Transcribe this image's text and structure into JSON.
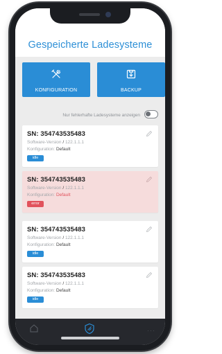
{
  "header": {
    "title": "Gespeicherte Ladesysteme"
  },
  "actions": [
    {
      "label": "KONFIGURATION",
      "icon": "tools-icon"
    },
    {
      "label": "BACKUP",
      "icon": "backup-icon"
    }
  ],
  "filter": {
    "label": "Nur fehlerhafte Ladesysteme anzeigen",
    "enabled": false
  },
  "cards": [
    {
      "sn": "SN: 354743535483",
      "sw_label": "Software-Version",
      "sw_sep": "/",
      "sw_value": "122.1.1.1",
      "cfg_label": "Konfiguration:",
      "cfg_value": "Default",
      "status": "idle"
    },
    {
      "sn": "SN: 354743535483",
      "sw_label": "Software-Version",
      "sw_sep": "/",
      "sw_value": "122.1.1.1",
      "cfg_label": "Konfiguration:",
      "cfg_value": "Default",
      "status": "error"
    },
    {
      "sn": "SN: 354743535483",
      "sw_label": "Software-Version",
      "sw_sep": "/",
      "sw_value": "122.1.1.1",
      "cfg_label": "Konfiguration:",
      "cfg_value": "Default",
      "status": "idle"
    },
    {
      "sn": "SN: 354743535483",
      "sw_label": "Software-Version",
      "sw_sep": "/",
      "sw_value": "122.1.1.1",
      "cfg_label": "Konfiguration:",
      "cfg_value": "Default",
      "status": "idle"
    }
  ],
  "tabbar": {
    "items": [
      "home-icon",
      "shield-icon",
      "more-icon"
    ],
    "more_glyph": "···"
  },
  "colors": {
    "accent": "#2a8dd6",
    "error": "#e1525c",
    "error_bg": "#f6dcdc",
    "tabbar": "#26282d"
  }
}
